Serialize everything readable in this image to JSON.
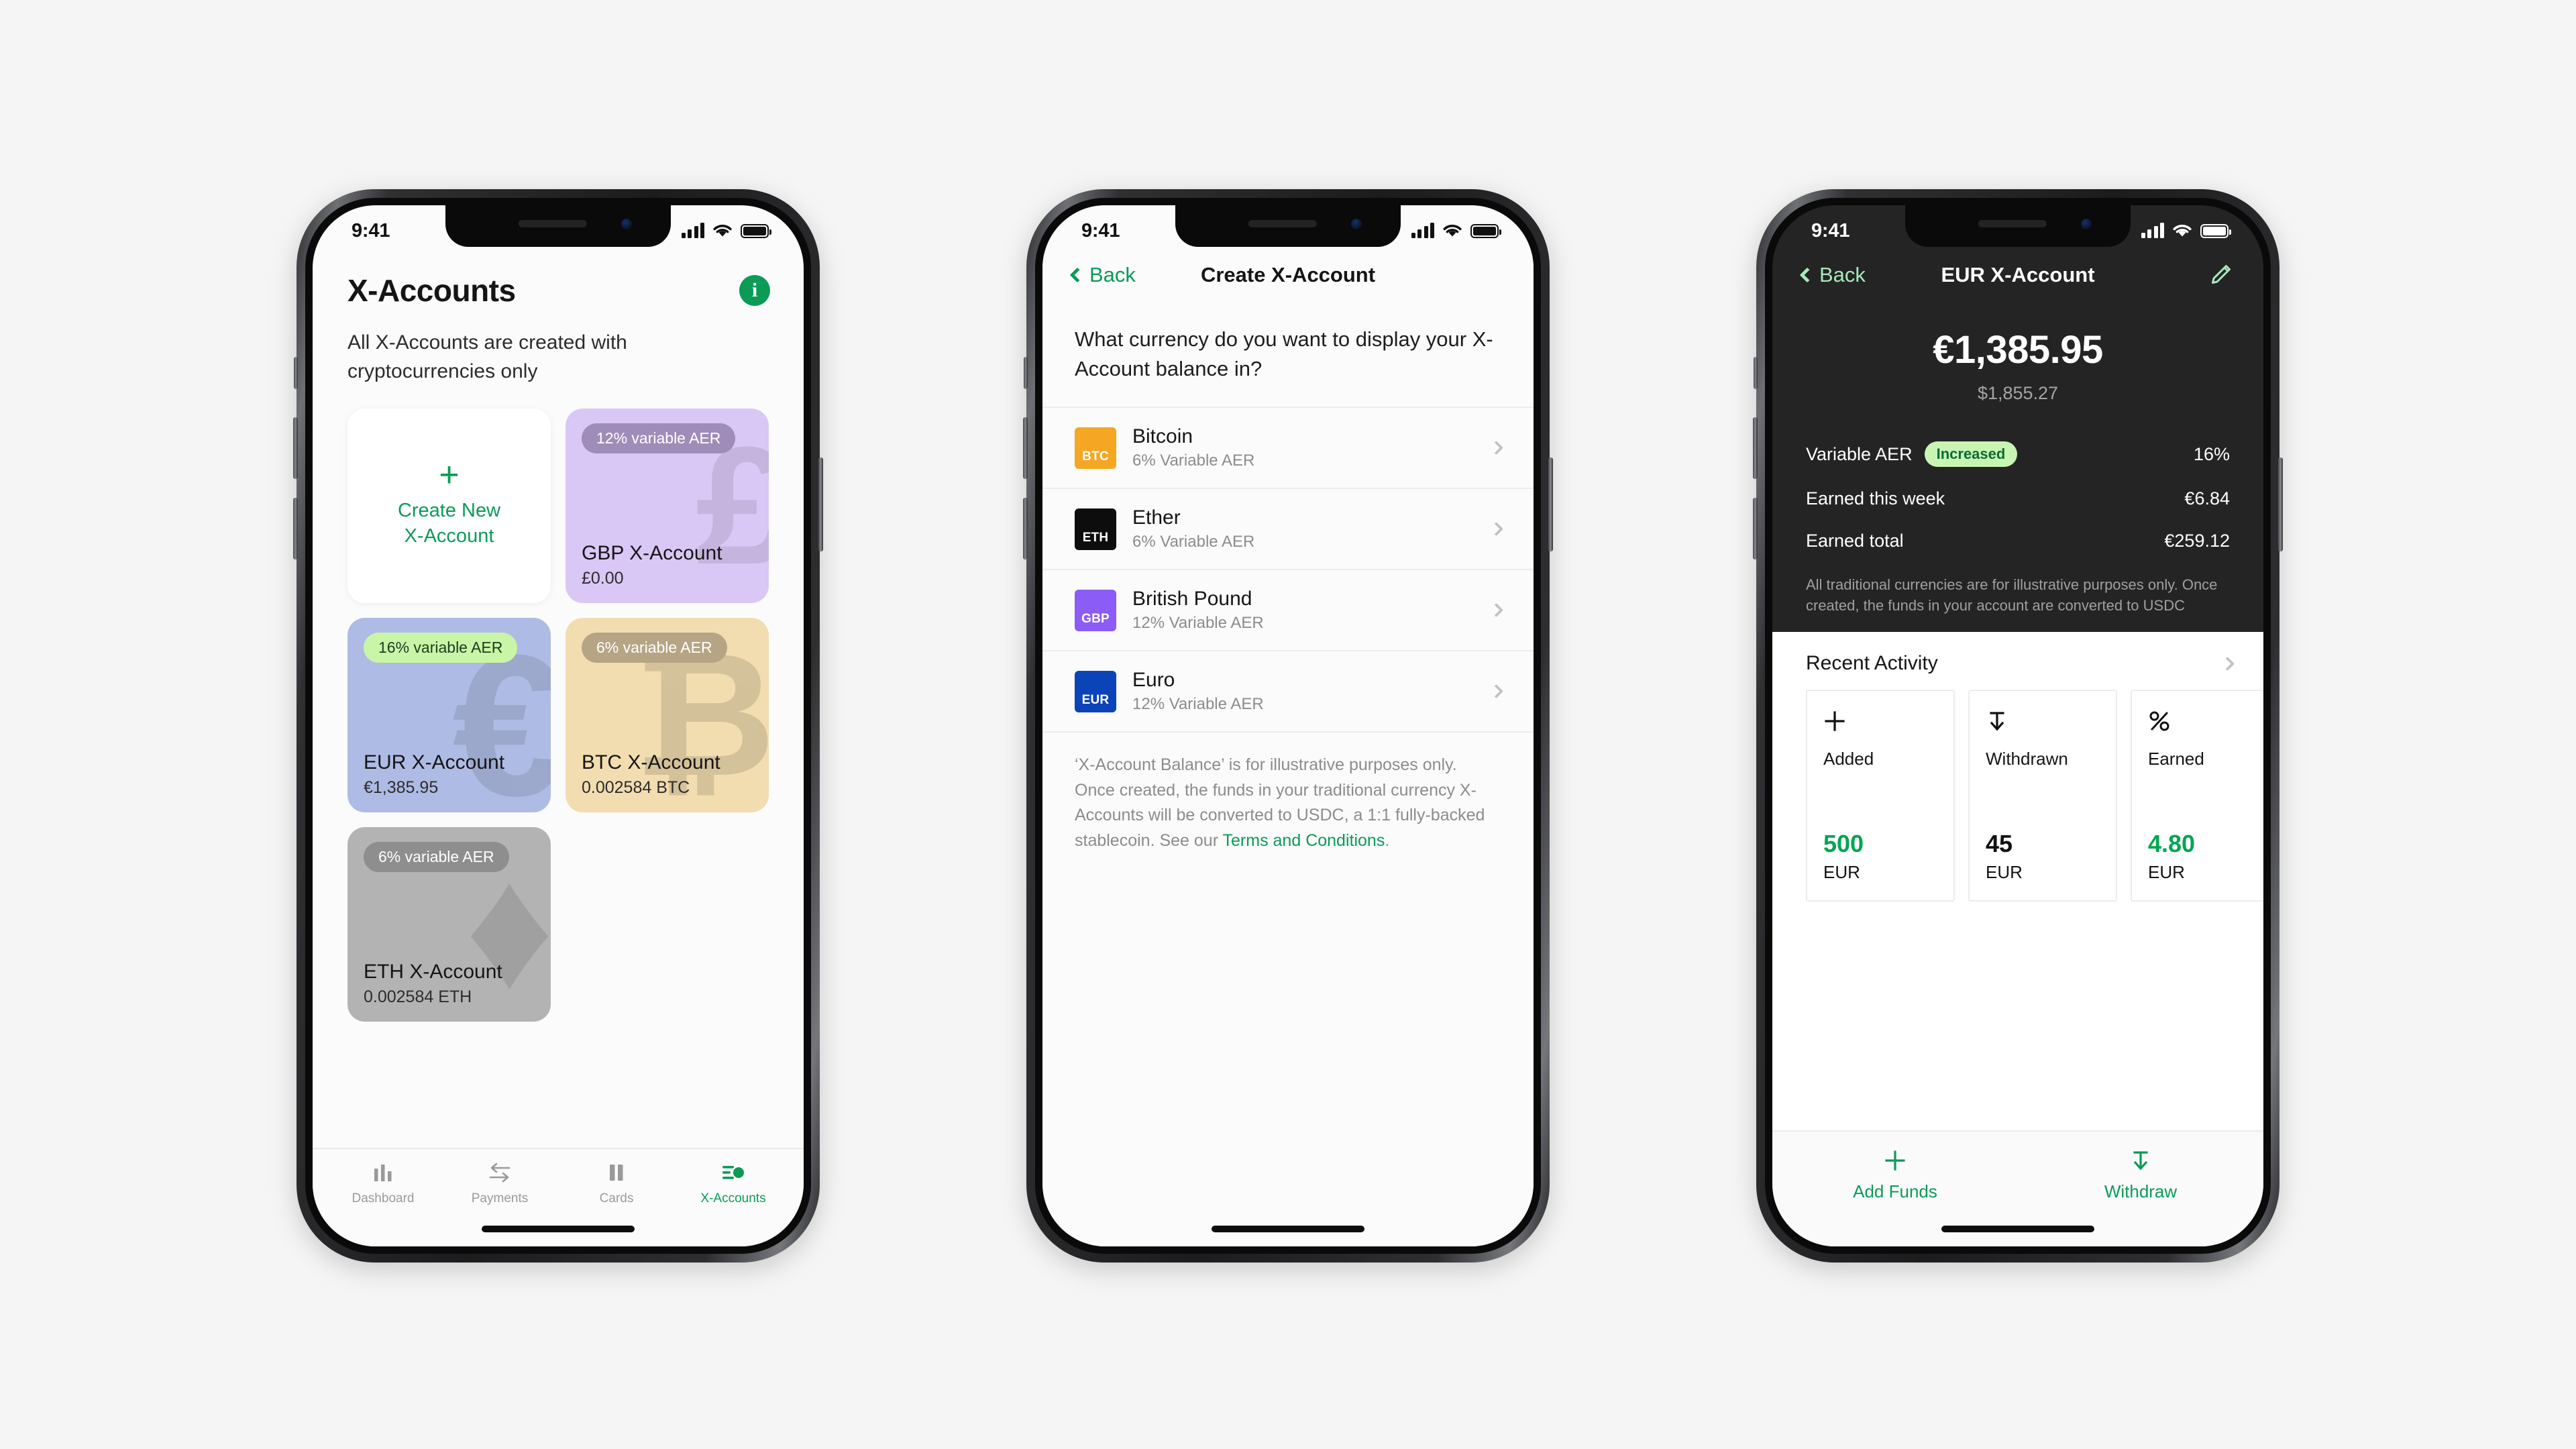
{
  "status_bar": {
    "time": "9:41"
  },
  "phone1": {
    "title": "X-Accounts",
    "info_icon": "info-icon",
    "subtitle": "All X-Accounts are created with cryptocurrencies only",
    "cards": [
      {
        "kind": "create",
        "plus": "+",
        "label": "Create New\nX-Account",
        "accent": "#0a9b57"
      },
      {
        "kind": "account",
        "badge": "12% variable AER",
        "name": "GBP X-Account",
        "balance": "£0.00",
        "bg": "#d9c7f5",
        "badge_bg": "#9f8cb8",
        "badge_fg": "#ffffff",
        "watermark": "£"
      },
      {
        "kind": "account",
        "badge": "16% variable AER",
        "name": "EUR X-Account",
        "balance": "€1,385.95",
        "bg": "#aebbe4",
        "badge_bg": "#c9f5a6",
        "badge_fg": "#1d3b1d",
        "watermark": "€"
      },
      {
        "kind": "account",
        "badge": "6% variable AER",
        "name": "BTC X-Account",
        "balance": "0.002584 BTC",
        "bg": "#f2ddb0",
        "badge_bg": "#b5a585",
        "badge_fg": "#ffffff",
        "watermark": "₿"
      },
      {
        "kind": "account",
        "badge": "6% variable AER",
        "name": "ETH X-Account",
        "balance": "0.002584 ETH",
        "bg": "#b3b3b3",
        "badge_bg": "#8e8e8e",
        "badge_fg": "#ffffff",
        "watermark": "♦"
      }
    ],
    "tabs": [
      {
        "label": "Dashboard",
        "icon": "bar-chart-icon",
        "active": false
      },
      {
        "label": "Payments",
        "icon": "transfer-arrows-icon",
        "active": false
      },
      {
        "label": "Cards",
        "icon": "cards-icon",
        "active": false
      },
      {
        "label": "X-Accounts",
        "icon": "x-accounts-icon",
        "active": true
      }
    ]
  },
  "phone2": {
    "back_label": "Back",
    "title": "Create X-Account",
    "question": "What currency do you want to display your X-Account balance in?",
    "currencies": [
      {
        "code": "BTC",
        "name": "Bitcoin",
        "aer": "6% Variable AER",
        "bg": "#f5a623",
        "fg": "#ffffff"
      },
      {
        "code": "ETH",
        "name": "Ether",
        "aer": "6% Variable AER",
        "bg": "#0d0d0d",
        "fg": "#ffffff"
      },
      {
        "code": "GBP",
        "name": "British Pound",
        "aer": "12% Variable AER",
        "bg": "#8b5cf6",
        "fg": "#ffffff"
      },
      {
        "code": "EUR",
        "name": "Euro",
        "aer": "12% Variable AER",
        "bg": "#0b43b8",
        "fg": "#ffffff"
      }
    ],
    "note_before": "‘X-Account Balance’ is for illustrative purposes only. Once created, the funds in your traditional currency X-Accounts will be converted to USDC, a 1:1 fully-backed stablecoin. See our ",
    "note_link": "Terms and Conditions",
    "note_after": "."
  },
  "phone3": {
    "back_label": "Back",
    "title": "EUR X-Account",
    "edit_icon": "pencil-icon",
    "balance": "€1,385.95",
    "balance_secondary": "$1,855.27",
    "stats": [
      {
        "label": "Variable AER",
        "pill": "Increased",
        "value": "16%"
      },
      {
        "label": "Earned this week",
        "pill": null,
        "value": "€6.84"
      },
      {
        "label": "Earned total",
        "pill": null,
        "value": "€259.12"
      }
    ],
    "note": "All traditional currencies are for illustrative purposes only. Once created, the funds in your account are converted to USDC",
    "recent_activity_title": "Recent Activity",
    "activity_cards": [
      {
        "icon": "plus-icon",
        "name": "Added",
        "amount": "500",
        "amount_color": "green",
        "currency": "EUR"
      },
      {
        "icon": "withdraw-icon",
        "name": "Withdrawn",
        "amount": "45",
        "amount_color": "black",
        "currency": "EUR"
      },
      {
        "icon": "percent-icon",
        "name": "Earned",
        "amount": "4.80",
        "amount_color": "green",
        "currency": "EUR"
      }
    ],
    "actions": [
      {
        "icon": "plus-icon",
        "label": "Add Funds"
      },
      {
        "icon": "withdraw-icon",
        "label": "Withdraw"
      }
    ]
  },
  "colors": {
    "brand_green": "#0a9b57",
    "accent_green": "#00a651",
    "mint": "#a9e8bd",
    "dark_bg": "#242424"
  }
}
